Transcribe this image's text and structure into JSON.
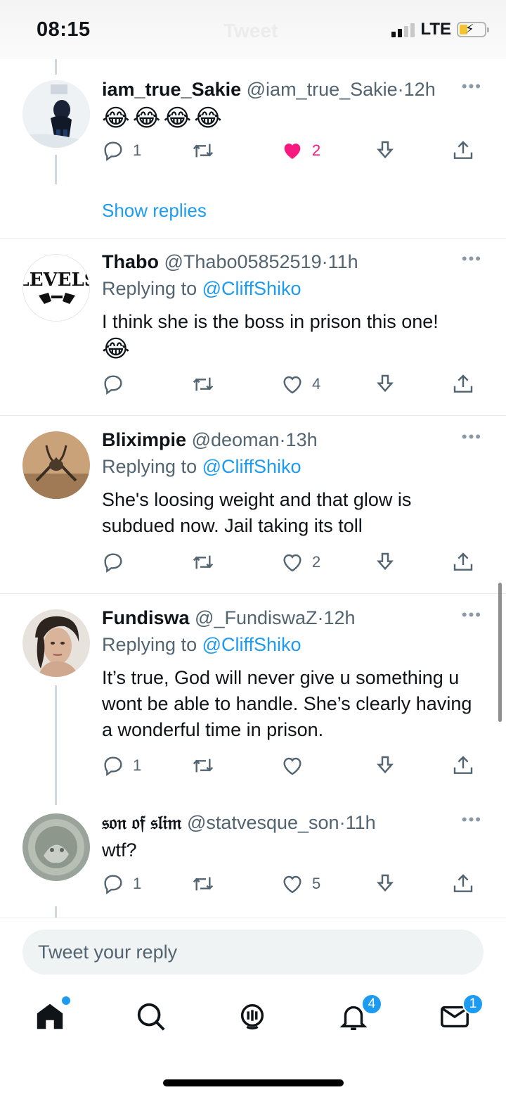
{
  "status_bar": {
    "time": "08:15",
    "network": "LTE",
    "ghost_title": "Tweet"
  },
  "tweets": [
    {
      "name": "iam_true_Sakie",
      "handle": "@iam_true_Sakie",
      "time": "12h",
      "body": "😂😂😂😂",
      "replies": "1",
      "retweets": "",
      "likes": "2",
      "liked": true
    },
    {
      "name": "Thabo",
      "handle": "@Thabo05852519",
      "time": "11h",
      "replying_prefix": "Replying to",
      "replying_to": "@CliffShiko",
      "body": "I think she is the boss in prison this one!",
      "emoji": "😂",
      "replies": "",
      "retweets": "",
      "likes": "4"
    },
    {
      "name": "Bliximpie",
      "handle": "@deoman",
      "time": "13h",
      "replying_prefix": "Replying to",
      "replying_to": "@CliffShiko",
      "body": "She's loosing weight and that glow is subdued now. Jail taking its toll",
      "replies": "",
      "retweets": "",
      "likes": "2"
    },
    {
      "name": "Fundiswa",
      "handle": "@_FundiswaZ",
      "time": "12h",
      "replying_prefix": "Replying to",
      "replying_to": "@CliffShiko",
      "body": "It’s true, God will never give u something u wont be able to handle. She’s clearly having a wonderful time in prison.",
      "replies": "1",
      "retweets": "",
      "likes": ""
    },
    {
      "name": "𝔰𝔬𝔫 𝔬𝔣 𝔰𝔩𝔦𝔪",
      "handle": "@statvesque_son",
      "time": "11h",
      "body": "wtf?",
      "replies": "1",
      "retweets": "",
      "likes": "5"
    }
  ],
  "show_replies": "Show replies",
  "more_glyph": "•••",
  "time_separator": "·",
  "composer": {
    "placeholder": "Tweet your reply"
  },
  "nav": {
    "notifications_badge": "4",
    "messages_badge": "1"
  },
  "colors": {
    "accent": "#1d9bf0",
    "like": "#f91880",
    "text": "#0f1419",
    "secondary": "#536471"
  }
}
